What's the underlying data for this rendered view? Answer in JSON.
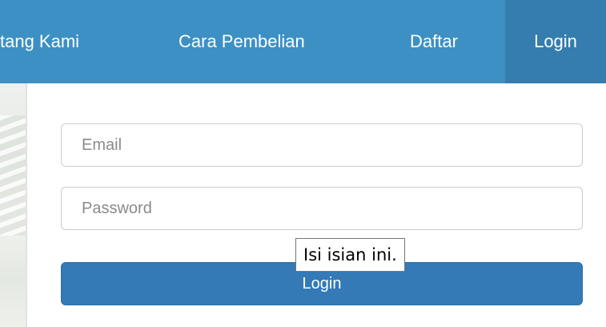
{
  "navbar": {
    "items": [
      {
        "label": "tang Kami"
      },
      {
        "label": "Cara Pembelian"
      },
      {
        "label": "Daftar"
      },
      {
        "label": "Login",
        "active": true
      }
    ],
    "colors": {
      "background": "#3d90c4",
      "active_background": "#357dae",
      "text": "#ffffff"
    }
  },
  "form": {
    "email_placeholder": "Email",
    "email_value": "",
    "password_placeholder": "Password",
    "password_value": "",
    "submit_label": "Login",
    "submit_color": "#337ab7"
  },
  "validation_tooltip": {
    "text": "Isi isian ini."
  }
}
